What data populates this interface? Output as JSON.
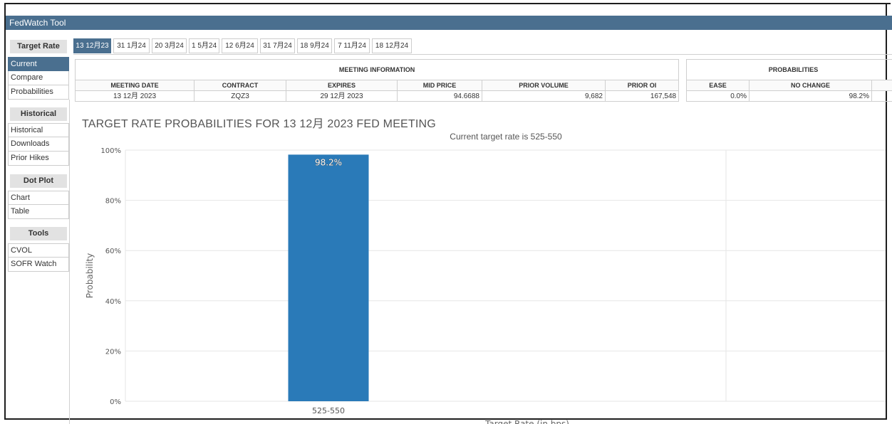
{
  "window": {
    "title": "FedWatch Tool"
  },
  "sidebar": {
    "sections": [
      {
        "heading": "Target Rate",
        "items": [
          {
            "label": "Current",
            "active": true
          },
          {
            "label": "Compare",
            "active": false
          },
          {
            "label": "Probabilities",
            "active": false
          }
        ]
      },
      {
        "heading": "Historical",
        "items": [
          {
            "label": "Historical",
            "active": false
          },
          {
            "label": "Downloads",
            "active": false
          },
          {
            "label": "Prior Hikes",
            "active": false
          }
        ]
      },
      {
        "heading": "Dot Plot",
        "items": [
          {
            "label": "Chart",
            "active": false
          },
          {
            "label": "Table",
            "active": false
          }
        ]
      },
      {
        "heading": "Tools",
        "items": [
          {
            "label": "CVOL",
            "active": false
          },
          {
            "label": "SOFR Watch",
            "active": false
          }
        ]
      }
    ]
  },
  "tabs": [
    {
      "label": "13 12月23",
      "active": true
    },
    {
      "label": "31 1月24"
    },
    {
      "label": "20 3月24"
    },
    {
      "label": "1 5月24"
    },
    {
      "label": "12 6月24"
    },
    {
      "label": "31 7月24"
    },
    {
      "label": "18 9月24"
    },
    {
      "label": "7 11月24"
    },
    {
      "label": "18 12月24"
    }
  ],
  "meeting_info": {
    "title": "MEETING INFORMATION",
    "headers": [
      "MEETING DATE",
      "CONTRACT",
      "EXPIRES",
      "MID PRICE",
      "PRIOR VOLUME",
      "PRIOR OI"
    ],
    "row": [
      "13 12月 2023",
      "ZQZ3",
      "29 12月 2023",
      "94.6688",
      "9,682",
      "167,548"
    ]
  },
  "probabilities": {
    "title": "PROBABILITIES",
    "headers": [
      "EASE",
      "NO CHANGE"
    ],
    "row": [
      "0.0%",
      "98.2%"
    ]
  },
  "chart": {
    "heading": "TARGET RATE PROBABILITIES FOR 13 12月 2023 FED MEETING",
    "subtitle": "Current target rate is 525-550"
  },
  "chart_data": {
    "type": "bar",
    "categories": [
      "525-550"
    ],
    "values": [
      98.2
    ],
    "data_labels": [
      "98.2%"
    ],
    "ylabel": "Probability",
    "xlabel": "Target Rate (in bps)",
    "yticks": [
      "0%",
      "20%",
      "40%",
      "60%",
      "80%",
      "100%"
    ],
    "ylim": [
      0,
      100
    ],
    "grid": true,
    "bar_color": "#2a7ab8"
  },
  "colors": {
    "accent": "#4a6f8f"
  }
}
